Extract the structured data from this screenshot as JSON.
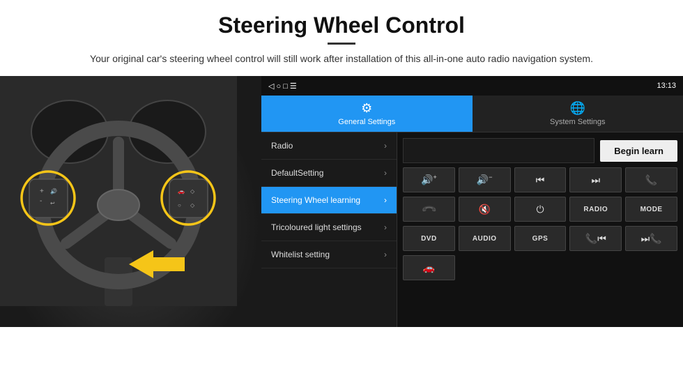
{
  "header": {
    "title": "Steering Wheel Control",
    "subtitle": "Your original car's steering wheel control will still work after installation of this all-in-one auto radio navigation system."
  },
  "statusBar": {
    "nav": "◁  ○  □  ☰",
    "time": "13:13",
    "icons": "♥ ▾"
  },
  "tabs": [
    {
      "id": "general",
      "icon": "⚙",
      "label": "General Settings",
      "active": true
    },
    {
      "id": "system",
      "icon": "🌐",
      "label": "System Settings",
      "active": false
    }
  ],
  "menu": {
    "items": [
      {
        "label": "Radio",
        "active": false
      },
      {
        "label": "DefaultSetting",
        "active": false
      },
      {
        "label": "Steering Wheel learning",
        "active": true
      },
      {
        "label": "Tricoloured light settings",
        "active": false
      },
      {
        "label": "Whitelist setting",
        "active": false
      }
    ]
  },
  "rightPanel": {
    "beginLearnLabel": "Begin learn",
    "buttons": {
      "row1": [
        {
          "icon": "🔊+",
          "label": ""
        },
        {
          "icon": "🔊-",
          "label": ""
        },
        {
          "icon": "⏮",
          "label": ""
        },
        {
          "icon": "⏭",
          "label": ""
        },
        {
          "icon": "📞",
          "label": ""
        }
      ],
      "row2": [
        {
          "icon": "📞↙",
          "label": ""
        },
        {
          "icon": "🔇",
          "label": ""
        },
        {
          "icon": "⏻",
          "label": ""
        },
        {
          "text": "RADIO",
          "label": "RADIO"
        },
        {
          "text": "MODE",
          "label": "MODE"
        }
      ],
      "row3": [
        {
          "text": "DVD",
          "label": "DVD"
        },
        {
          "text": "AUDIO",
          "label": "AUDIO"
        },
        {
          "text": "GPS",
          "label": "GPS"
        },
        {
          "icon": "📞⏮",
          "label": ""
        },
        {
          "icon": "⏭📞",
          "label": ""
        }
      ],
      "row4": [
        {
          "icon": "🚗",
          "label": ""
        }
      ]
    }
  }
}
